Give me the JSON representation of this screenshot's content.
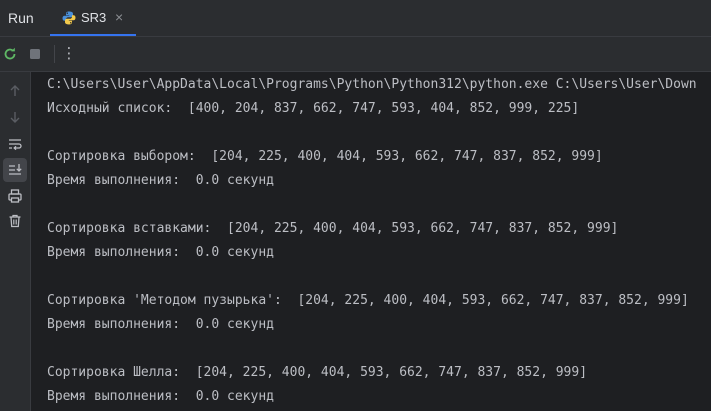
{
  "run_panel": {
    "title": "Run",
    "tab": {
      "label": "SR3",
      "icon": "python-icon",
      "close": "×"
    }
  },
  "toolbar": {
    "buttons": [
      "rerun-icon",
      "stop-icon",
      "more-icon"
    ],
    "more_label": "⋮"
  },
  "sidebar": {
    "buttons": [
      "arrow-up-icon",
      "arrow-down-icon",
      "soft-wrap-icon",
      "scroll-to-end-icon",
      "print-icon",
      "delete-icon"
    ]
  },
  "console": {
    "lines": [
      "C:\\Users\\User\\AppData\\Local\\Programs\\Python\\Python312\\python.exe C:\\Users\\User\\Down",
      "Исходный список:  [400, 204, 837, 662, 747, 593, 404, 852, 999, 225]",
      "",
      "Сортировка выбором:  [204, 225, 400, 404, 593, 662, 747, 837, 852, 999]",
      "Время выполнения:  0.0 секунд",
      "",
      "Сортировка вставками:  [204, 225, 400, 404, 593, 662, 747, 837, 852, 999]",
      "Время выполнения:  0.0 секунд",
      "",
      "Сортировка 'Методом пузырька':  [204, 225, 400, 404, 593, 662, 747, 837, 852, 999]",
      "Время выполнения:  0.0 секунд",
      "",
      "Сортировка Шелла:  [204, 225, 400, 404, 593, 662, 747, 837, 852, 999]",
      "Время выполнения:  0.0 секунд"
    ]
  },
  "colors": {
    "background": "#1e1f22",
    "panel": "#2b2d30",
    "text": "#bcbec4",
    "accent": "#3574f0",
    "rerun_green": "#5fb865"
  }
}
